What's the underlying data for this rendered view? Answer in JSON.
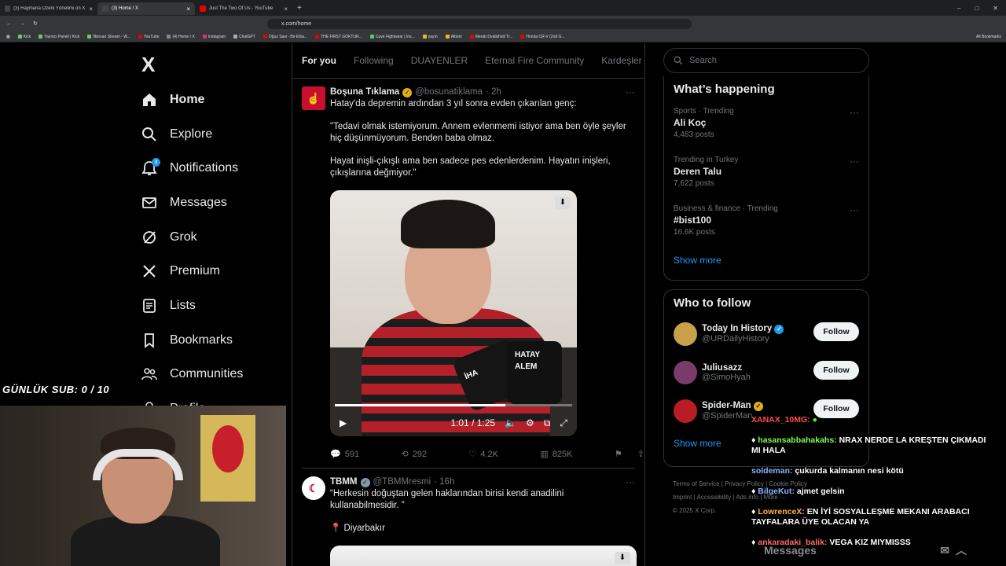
{
  "browser": {
    "tabs": [
      {
        "label": "(3) Haymana Özerk Yönetimi on X: \"I...",
        "active": false
      },
      {
        "label": "(3) Home / X",
        "active": true
      },
      {
        "label": "Just The Two Of Us - YouTube",
        "active": false
      }
    ],
    "url": "x.com/home",
    "bookmarks": [
      "Kick",
      "Yayıncı Paneli | Kick",
      "İlkinsan Stream - W...",
      "YouTube",
      "(4) Home / X",
      "Instagram",
      "ChatGPT",
      "Oğuz Sasi - Bir Efsa...",
      "THE FIRST GOKTUR...",
      "Cave Fightwear | Ins...",
      "yayın",
      "Albüm",
      "Merab Dvalishvili Tr...",
      "Honda CR-V (2nd G..."
    ],
    "all_bookmarks": "All Bookmarks"
  },
  "nav": {
    "logo": "X",
    "items": [
      {
        "label": "Home",
        "icon": "home-icon"
      },
      {
        "label": "Explore",
        "icon": "search-icon"
      },
      {
        "label": "Notifications",
        "icon": "bell-icon",
        "badge": "3"
      },
      {
        "label": "Messages",
        "icon": "mail-icon"
      },
      {
        "label": "Grok",
        "icon": "grok-icon"
      },
      {
        "label": "Premium",
        "icon": "x-icon"
      },
      {
        "label": "Lists",
        "icon": "list-icon"
      },
      {
        "label": "Bookmarks",
        "icon": "bookmark-icon"
      },
      {
        "label": "Communities",
        "icon": "people-icon"
      },
      {
        "label": "Profile",
        "icon": "user-icon"
      }
    ]
  },
  "feed": {
    "tabs": [
      "For you",
      "Following",
      "DUAYENLER",
      "Eternal Fire Community",
      "Kardeşler Ki"
    ],
    "tweet1": {
      "name": "Boşuna Tıklama",
      "handle": "@bosunatiklama",
      "time": "· 2h",
      "p1": "Hatay'da depremin ardından 3 yıl sonra evden çıkarılan genç:",
      "p2": "\"Tedavi olmak istemiyorum. Annem evlenmemi istiyor ama ben öyle şeyler hiç düşünmüyorum. Benden baba olmaz.",
      "p3": "Hayat inişli-çıkışlı ama ben sadece pes edenlerdenim. Hayatın inişleri, çıkışlarına değmiyor.\"",
      "video_time": "1:01 / 1:25",
      "video_progress": 0.72,
      "mic_label_1": "İHA",
      "mic_label_2": "HATAY ALEM",
      "replies": "591",
      "reposts": "292",
      "likes": "4.2K",
      "views": "825K"
    },
    "tweet2": {
      "name": "TBMM",
      "handle": "@TBMMresmi",
      "time": "· 16h",
      "text": "“Herkesin doğuştan gelen haklarından birisi kendi anadilini kullanabilmesidir. ”",
      "location": "Diyarbakır"
    }
  },
  "right": {
    "search_placeholder": "Search",
    "happening_title": "What’s happening",
    "trends": [
      {
        "category": "Sports · Trending",
        "name": "Ali Koç",
        "count": "4,483 posts"
      },
      {
        "category": "Trending in Turkey",
        "name": "Deren Talu",
        "count": "7,622 posts"
      },
      {
        "category": "Business & finance · Trending",
        "name": "#bist100",
        "count": "16.6K posts"
      }
    ],
    "show_more": "Show more",
    "who_title": "Who to follow",
    "follow": [
      {
        "name": "Today In History",
        "handle": "@URDailyHistory",
        "button": "Follow",
        "color": "#c9a04a"
      },
      {
        "name": "Juliusazz",
        "handle": "@SimoHyah",
        "button": "Follow",
        "color": "#7a3a6a"
      },
      {
        "name": "Spider-Man",
        "handle": "@SpiderMan",
        "button": "Follow",
        "color": "#b81d24"
      }
    ],
    "show_more_2": "Show more",
    "footer": [
      "Terms of Service",
      "Privacy Policy",
      "Cookie Policy",
      "Imprint",
      "Accessibility",
      "Ads info",
      "More ···",
      "© 2025 X Corp."
    ]
  },
  "stream": {
    "sub_counter": "GÜNLÜK SUB: 0 / 10",
    "chat": [
      {
        "user": "XANAX_10MG:",
        "text": "",
        "color": "#ff4d4d"
      },
      {
        "user": "hasansabbahakahs:",
        "text": "NRAX NERDE LA KREŞTEN ÇIKMADI MI HALA",
        "color": "#7cfc5a"
      },
      {
        "user": "soldeman:",
        "text": "çukurda kalmanın nesi kötü",
        "color": "#8ab4ff"
      },
      {
        "user": "BilgeKut:",
        "text": "ajmet gelsin",
        "color": "#8ab4ff"
      },
      {
        "user": "LowrenceX:",
        "text": "EN İYİ SOSYALLEŞME MEKANI ARABACI TAYFALARA ÜYE OLACAN YA",
        "color": "#ffb347"
      },
      {
        "user": "ankaradaki_balik:",
        "text": "VEGA KIZ MIYMISSS",
        "color": "#ff6b6b"
      }
    ],
    "messages_label": "Messages"
  }
}
